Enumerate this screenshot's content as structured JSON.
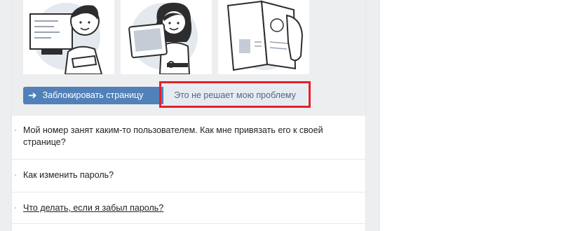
{
  "actions": {
    "block_label": "Заблокировать страницу",
    "block_icon": "arrow-right-icon",
    "not_solved_label": "Это не решает мою проблему"
  },
  "illustrations": [
    {
      "icon": "person-at-computer-illustration"
    },
    {
      "icon": "woman-with-tablet-illustration"
    },
    {
      "icon": "passport-in-hand-illustration"
    }
  ],
  "faq": [
    {
      "text": "Мой номер занят каким-то пользователем. Как мне привязать его к своей странице?"
    },
    {
      "text": "Как изменить пароль?"
    },
    {
      "text": "Что делать, если я забыл пароль?"
    }
  ],
  "colors": {
    "primary": "#5181b8",
    "secondary": "#e5ebf1",
    "highlight": "#e3212d",
    "background": "#edeef0"
  }
}
